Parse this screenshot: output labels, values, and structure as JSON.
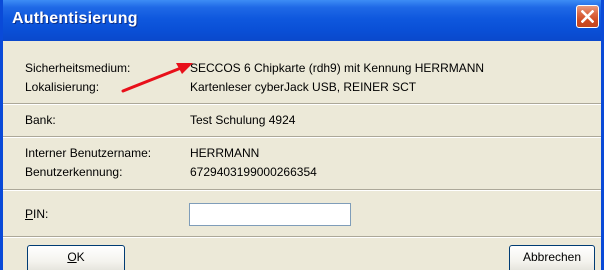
{
  "window": {
    "title": "Authentisierung"
  },
  "fields": {
    "medium_label": "Sicherheitsmedium:",
    "medium_value": "SECCOS 6 Chipkarte (rdh9) mit Kennung HERRMANN",
    "location_label": "Lokalisierung:",
    "location_value": "Kartenleser cyberJack USB, REINER SCT",
    "bank_label": "Bank:",
    "bank_value": "Test Schulung 4924",
    "internal_user_label": "Interner Benutzername:",
    "internal_user_value": "HERRMANN",
    "user_id_label": "Benutzerkennung:",
    "user_id_value": "6729403199000266354",
    "pin_label_mnemonic": "P",
    "pin_label_rest": "IN:",
    "pin_value": ""
  },
  "buttons": {
    "ok_mnemonic": "O",
    "ok_rest": "K",
    "cancel_label": "Abbrechen"
  },
  "annotation": {
    "arrow_color": "#e8101a"
  },
  "colors": {
    "titlebar": "#0a4fd6",
    "close": "#cf4b22",
    "background": "#ece9d8"
  }
}
